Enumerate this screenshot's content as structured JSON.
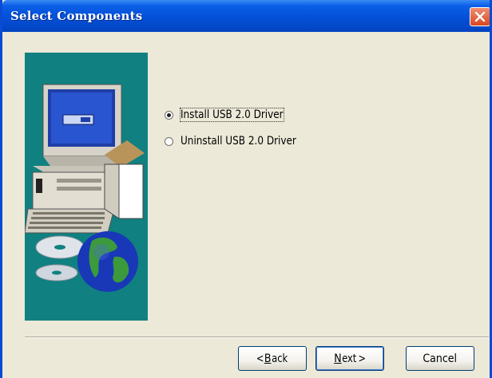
{
  "window": {
    "title": "Select Components"
  },
  "options": [
    {
      "label": "Install USB 2.0 Driver",
      "checked": true
    },
    {
      "label": "Uninstall USB 2.0 Driver",
      "checked": false
    }
  ],
  "buttons": {
    "back": {
      "mnemonic": "B",
      "rest": "ack",
      "prefix": "< "
    },
    "next": {
      "mnemonic": "N",
      "rest": "ext",
      "suffix": " >"
    },
    "cancel": "Cancel"
  },
  "colors": {
    "title_bar": "#0450d8",
    "dialog_bg": "#ece9d8",
    "art_panel_bg": "#108080",
    "close_button": "#d8471f"
  },
  "icons": {
    "illustration": "computer-with-cds-and-globe-icon",
    "close": "close-icon"
  }
}
